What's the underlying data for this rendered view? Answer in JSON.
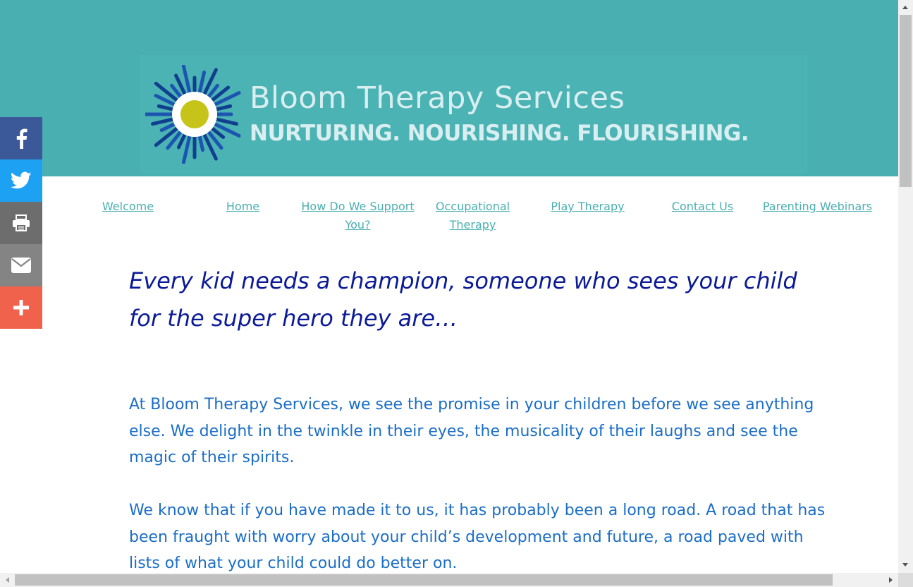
{
  "brand": {
    "name": "Bloom Therapy Services",
    "tagline": "NURTURING. NOURISHING. FLOURISHING."
  },
  "nav": {
    "items": [
      {
        "label": "Welcome"
      },
      {
        "label": "Home"
      },
      {
        "label": "How Do We Support You?"
      },
      {
        "label": "Occupational Therapy"
      },
      {
        "label": "Play Therapy"
      },
      {
        "label": "Contact Us"
      },
      {
        "label": "Parenting Webinars"
      }
    ]
  },
  "share": {
    "icons": [
      "facebook-icon",
      "twitter-icon",
      "print-icon",
      "email-icon",
      "plus-icon"
    ],
    "colors": {
      "facebook": "#3b5998",
      "twitter": "#1da1f2",
      "print": "#6d6d6d",
      "email": "#848484",
      "more": "#f0624b"
    }
  },
  "content": {
    "headline": "Every kid needs a champion, someone who sees your child for the super hero they are…",
    "paragraphs": [
      "At Bloom Therapy Services, we see the promise in your children before we see anything else. We delight in the twinkle in their eyes, the musicality of their laughs and see the magic of their spirits.",
      "We know that if you have made it to us, it has probably been a long road. A road that has been fraught with worry about your child’s development and future, a road paved with lists of what your child could do better on."
    ]
  },
  "colors": {
    "header_bg": "#4aafb1",
    "headline": "#0b1a96",
    "body_text": "#1b6ec6",
    "nav_link": "#4aafb1"
  }
}
